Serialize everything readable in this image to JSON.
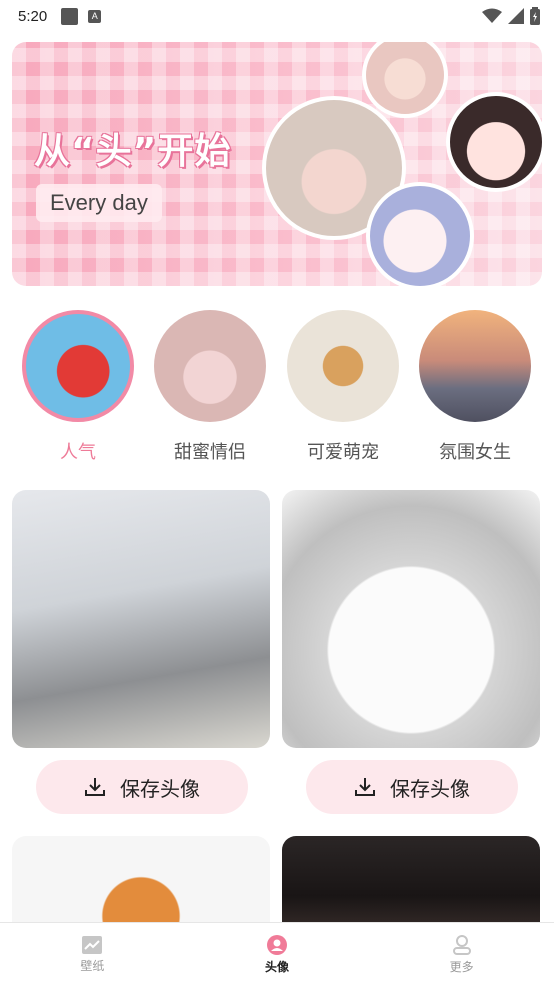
{
  "status_bar": {
    "time": "5:20",
    "a_badge": "A",
    "icons": [
      "notification-square-icon",
      "a-badge-icon",
      "wifi-icon",
      "signal-icon",
      "battery-icon"
    ]
  },
  "banner": {
    "title": "从“头”开始",
    "subtitle": "Every day"
  },
  "categories": [
    {
      "label": "人气",
      "icon": "hot-avatar",
      "active": true
    },
    {
      "label": "甜蜜情侣",
      "icon": "couple-avatar",
      "active": false
    },
    {
      "label": "可爱萌宠",
      "icon": "pet-avatar",
      "active": false
    },
    {
      "label": "氛围女生",
      "icon": "girl-avatar",
      "active": false
    }
  ],
  "cards": [
    {
      "save_label": "保存头像"
    },
    {
      "save_label": "保存头像"
    }
  ],
  "bottom_nav": [
    {
      "label": "壁纸",
      "icon": "chart-wallpaper-icon",
      "active": false
    },
    {
      "label": "头像",
      "icon": "user-avatar-icon",
      "active": true
    },
    {
      "label": "更多",
      "icon": "person-more-icon",
      "active": false
    }
  ],
  "colors": {
    "accent": "#ee7b98",
    "button_bg": "#fde8ec",
    "banner_pink": "#f8a9bd"
  }
}
